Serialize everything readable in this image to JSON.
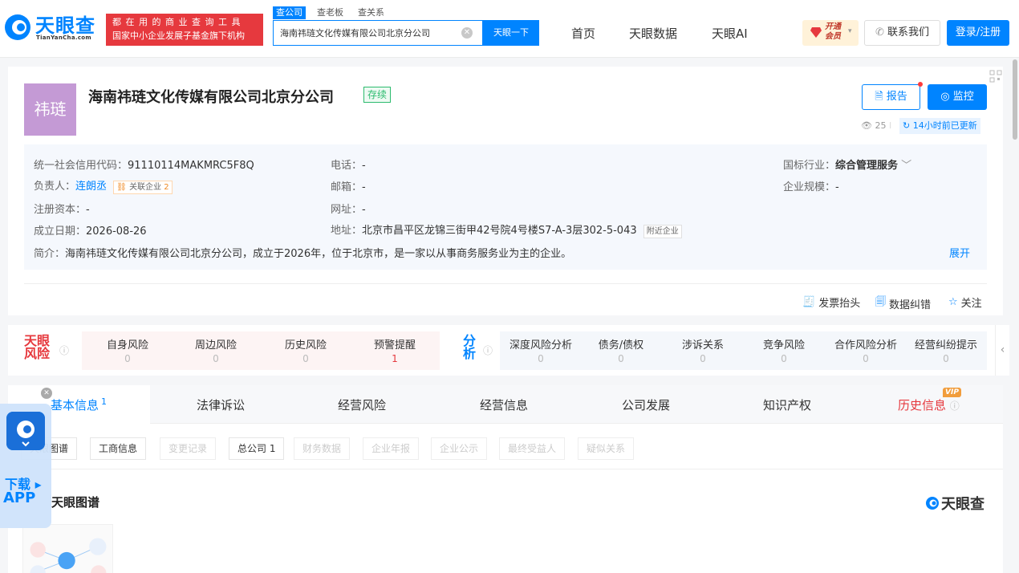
{
  "header": {
    "logo_text": "天眼查",
    "logo_sub": "TianYanCha.com",
    "slogan_line1": "都在用的商业查询工具",
    "slogan_line2": "国家中小企业发展子基金旗下机构",
    "search_tabs": [
      "查公司",
      "查老板",
      "查关系"
    ],
    "search_value": "海南祎琏文化传媒有限公司北京分公司",
    "search_button": "天眼一下",
    "nav": [
      "首页",
      "天眼数据",
      "天眼AI"
    ],
    "vip_label_top": "开通",
    "vip_label_bottom": "会员",
    "contact": "联系我们",
    "login": "登录/注册"
  },
  "company": {
    "avatar_text": "祎琏",
    "name": "海南祎琏文化传媒有限公司北京分公司",
    "status": "存续",
    "report_btn": "报告",
    "monitor_btn": "监控",
    "views": "25",
    "updated": "14小时前已更新",
    "credit_code_label": "统一社会信用代码：",
    "credit_code": "91110114MAKMRC5F8Q",
    "legal_label": "负责人：",
    "legal_person": "连朗丞",
    "related_label": "关联企业",
    "related_count": "2",
    "capital_label": "注册资本：",
    "capital": "-",
    "found_label": "成立日期：",
    "found_date": "2026-08-26",
    "phone_label": "电话：",
    "phone": "-",
    "email_label": "邮箱：",
    "email": "-",
    "website_label": "网址：",
    "website": "-",
    "address_label": "地址：",
    "address": "北京市昌平区龙锦三街甲42号院4号楼S7-A-3层302-5-043",
    "nearby_label": "附近企业",
    "industry_label": "国标行业：",
    "industry": "综合管理服务",
    "scale_label": "企业规模：",
    "scale": "-",
    "intro_label": "简介：",
    "intro": "海南祎琏文化传媒有限公司北京分公司，成立于2026年，位于北京市，是一家以从事商务服务业为主的企业。",
    "expand": "展开",
    "actions": [
      "发票抬头",
      "数据纠错",
      "关注"
    ]
  },
  "risk": {
    "logo_top": "天眼",
    "logo_bottom": "风险",
    "items": [
      {
        "label": "自身风险",
        "count": "0"
      },
      {
        "label": "周边风险",
        "count": "0"
      },
      {
        "label": "历史风险",
        "count": "0"
      },
      {
        "label": "预警提醒",
        "count": "1"
      }
    ],
    "analysis_logo_top": "分",
    "analysis_logo_bottom": "析",
    "analysis": [
      {
        "label": "深度风险分析",
        "count": "0"
      },
      {
        "label": "债务/债权",
        "count": "0"
      },
      {
        "label": "涉诉关系",
        "count": "0"
      },
      {
        "label": "竞争风险",
        "count": "0"
      },
      {
        "label": "合作风险分析",
        "count": "0"
      },
      {
        "label": "经营纠纷提示",
        "count": "0"
      }
    ]
  },
  "tabs": [
    {
      "label": "基本信息",
      "count": "1"
    },
    {
      "label": "法律诉讼",
      "count": ""
    },
    {
      "label": "经营风险",
      "count": ""
    },
    {
      "label": "经营信息",
      "count": ""
    },
    {
      "label": "公司发展",
      "count": ""
    },
    {
      "label": "知识产权",
      "count": ""
    },
    {
      "label": "历史信息",
      "count": ""
    }
  ],
  "vip_tag": "VIP",
  "subtabs": [
    {
      "label": "天眼图谱"
    },
    {
      "label": "工商信息"
    },
    {
      "label": "变更记录"
    },
    {
      "label": "总公司 1"
    },
    {
      "label": "财务数据"
    },
    {
      "label": "企业年报"
    },
    {
      "label": "企业公示"
    },
    {
      "label": "最终受益人"
    },
    {
      "label": "疑似关系"
    }
  ],
  "graph_title": "天眼图谱",
  "graph_brand": "天眼查",
  "float": {
    "line1": "下载 ▸",
    "line2": "APP"
  },
  "colors": {
    "brand": "#0084ff",
    "danger": "#e6393e",
    "status_green": "#2cbb6e"
  }
}
